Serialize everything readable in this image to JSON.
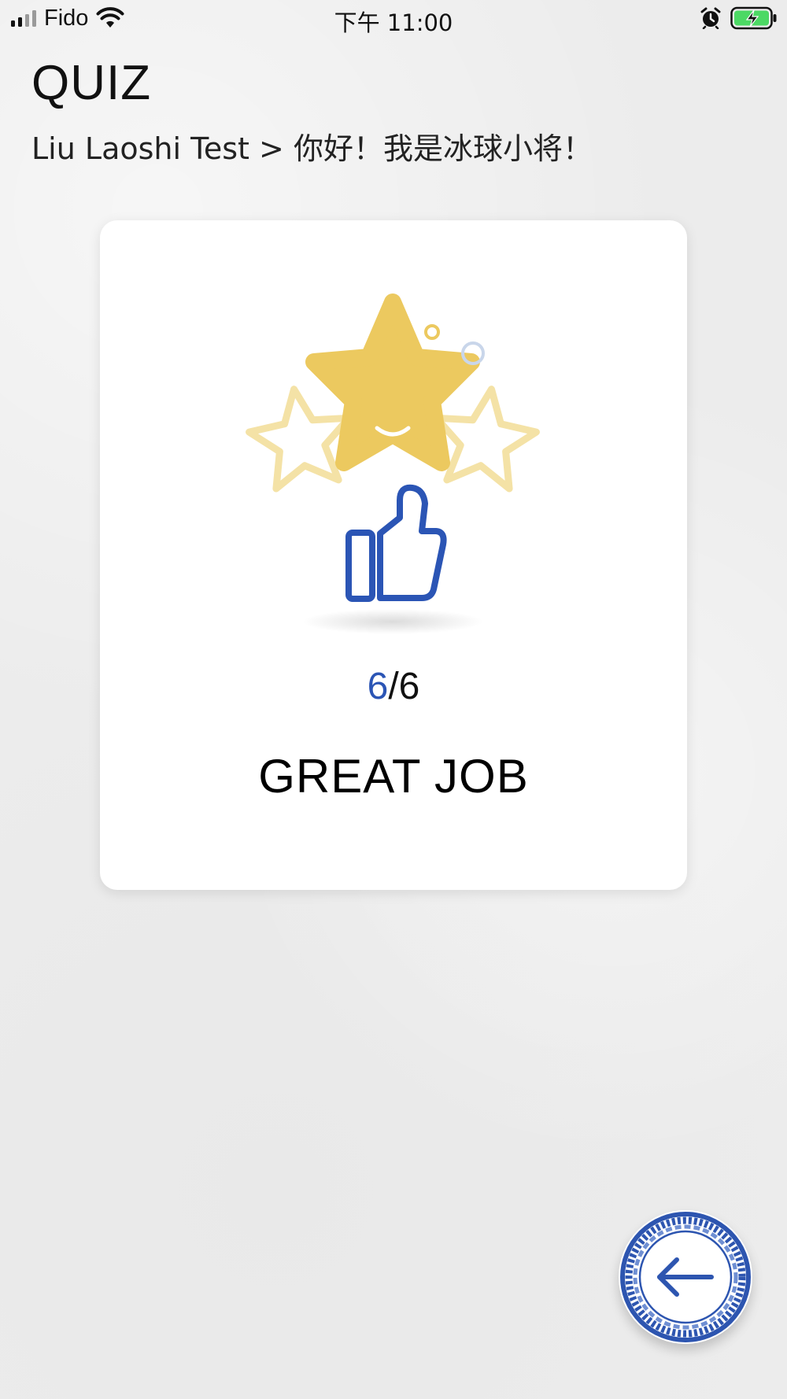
{
  "status_bar": {
    "carrier": "Fido",
    "time": "下午 11:00",
    "signal_bars_active": 2,
    "signal_bars_total": 4,
    "battery_state": "charging"
  },
  "header": {
    "title": "QUIZ",
    "breadcrumb": "Liu Laoshi Test > 你好！我是冰球小将！"
  },
  "result": {
    "score_correct": "6",
    "score_separator": "/",
    "score_total": "6",
    "message": "GREAT JOB",
    "illustration": "star-thumbs-up-icon"
  },
  "colors": {
    "accent_blue": "#2b55b5",
    "star_gold": "#ecc95f",
    "star_light": "#f4e2a6",
    "bubble_blue": "#c9d6ea"
  },
  "back_button": {
    "icon": "arrow-left-icon"
  }
}
